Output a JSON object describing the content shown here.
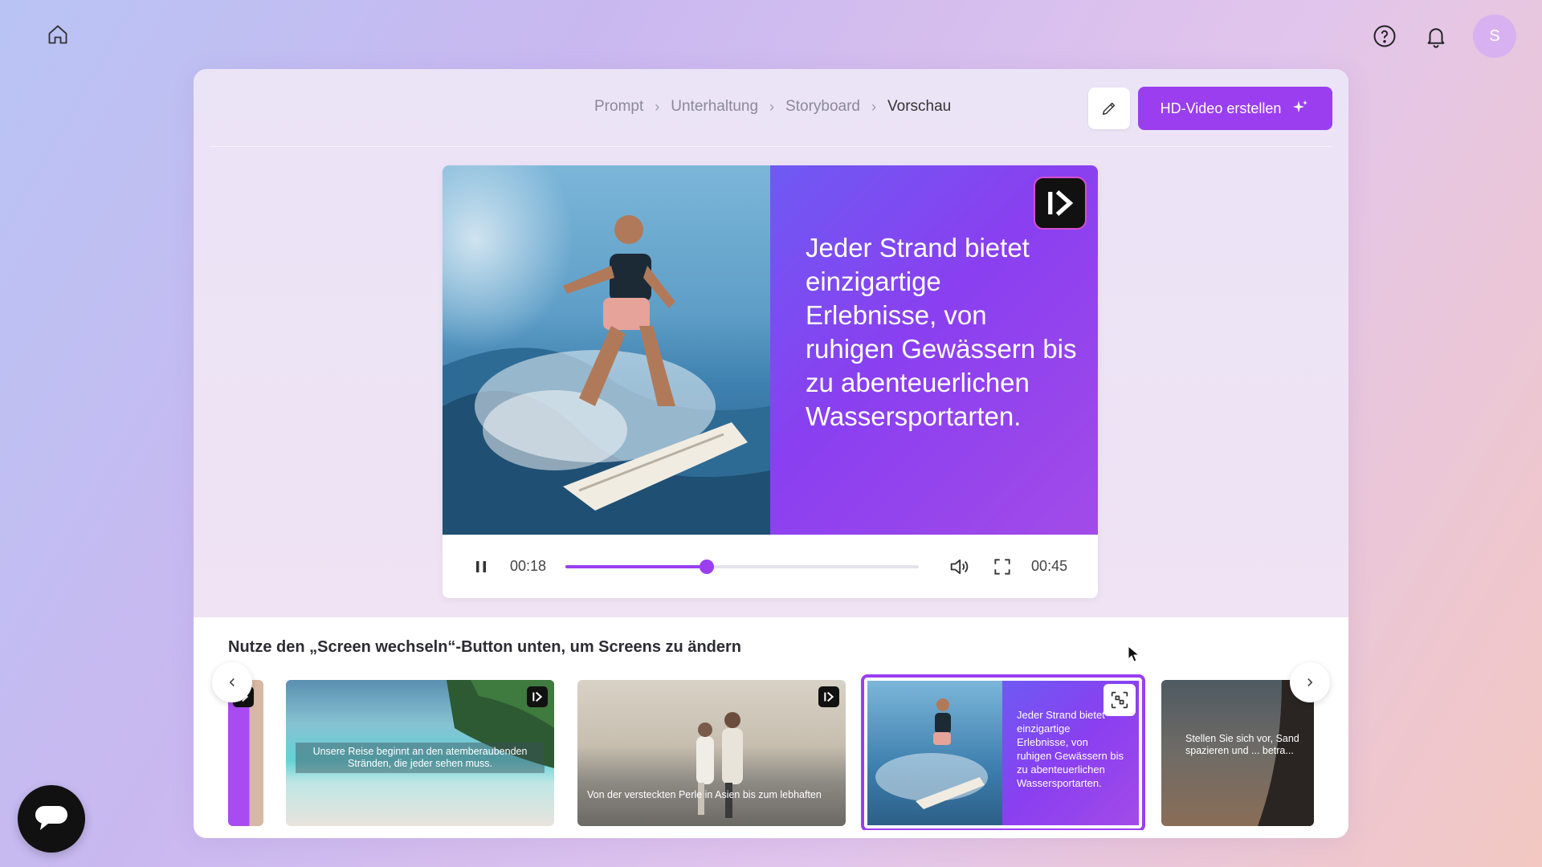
{
  "topbar": {
    "home_icon": "home-icon",
    "help_icon": "help-circle-icon",
    "notification_icon": "bell-icon",
    "avatar_initial": "S"
  },
  "breadcrumb": [
    "Prompt",
    "Unterhaltung",
    "Storyboard",
    "Vorschau"
  ],
  "actions": {
    "edit_icon": "pencil-icon",
    "hd_button_label": "HD-Video erstellen",
    "hd_button_icon": "sparkle-icon"
  },
  "player": {
    "caption": "Jeder Strand bietet einzigartige Erlebnisse, von ruhigen Gewässern bis zu abenteuerlichen Wassersportarten.",
    "current_time": "00:18",
    "duration": "00:45",
    "progress_fraction": 0.4
  },
  "screens": {
    "instruction": "Nutze den „Screen wechseln“-Button unten, um Screens zu ändern",
    "items": [
      {
        "caption": ""
      },
      {
        "caption": "Unsere Reise beginnt an den atemberaubenden Stränden, die jeder sehen muss."
      },
      {
        "caption": "Von der versteckten Perle in Asien bis zum lebhaften"
      },
      {
        "caption": "Jeder Strand bietet einzigartige Erlebnisse, von ruhigen Gewässern bis zu abenteuerlichen Wassersportarten."
      },
      {
        "caption": "Stellen Sie sich vor, Sand spazieren und ... betra..."
      }
    ]
  },
  "colors": {
    "accent": "#9a3ef0",
    "panel_bg": "#ebe4f6"
  }
}
